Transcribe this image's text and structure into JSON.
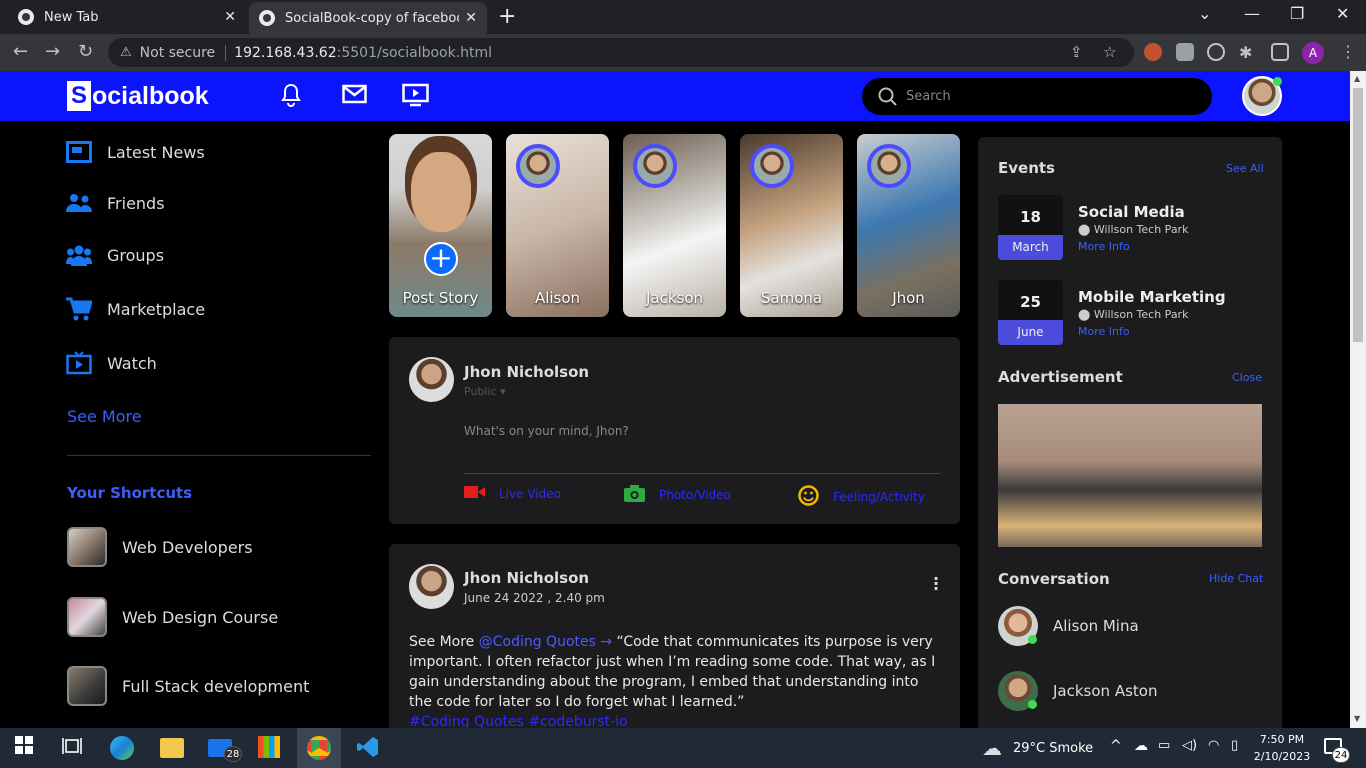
{
  "browser": {
    "tabs": [
      {
        "title": "New Tab",
        "close": "✕"
      },
      {
        "title": "SocialBook-copy of facebook",
        "close": "✕"
      }
    ],
    "new_tab": "+",
    "security_label": "Not secure",
    "url_host": "192.168.43.62",
    "url_path": ":5501/socialbook.html",
    "profile_initial": "A"
  },
  "site": {
    "logo_s": "S",
    "logo_rest": "ocialbook",
    "search_placeholder": "Search"
  },
  "sidebar": {
    "items": [
      {
        "label": "Latest News"
      },
      {
        "label": "Friends"
      },
      {
        "label": "Groups"
      },
      {
        "label": "Marketplace"
      },
      {
        "label": "Watch"
      }
    ],
    "see_more": "See More",
    "shortcuts_title": "Your Shortcuts",
    "shortcuts": [
      {
        "label": "Web Developers"
      },
      {
        "label": "Web Design Course"
      },
      {
        "label": "Full Stack development"
      }
    ]
  },
  "stories": [
    {
      "label": "Post Story"
    },
    {
      "label": "Alison"
    },
    {
      "label": "Jackson"
    },
    {
      "label": "Samona"
    },
    {
      "label": "Jhon"
    }
  ],
  "composer": {
    "name": "Jhon Nicholson",
    "privacy": "Public",
    "placeholder": "What's on your mind, Jhon?",
    "actions": [
      {
        "label": "Live Video"
      },
      {
        "label": "Photo/Video"
      },
      {
        "label": "Feeling/Activity"
      }
    ]
  },
  "post": {
    "name": "Jhon Nicholson",
    "date": "June 24 2022 , 2.40 pm",
    "see_more": "See More ",
    "mention": "@Coding Quotes →",
    "text": " “Code that communicates its purpose is very important. I often refactor just when I’m reading some code. That way, as I gain understanding about the program, I embed that understanding into the code for later so I do forget what I learned.”",
    "tags": "#Coding Quotes #codeburst-io"
  },
  "right": {
    "events_title": "Events",
    "events_link": "See All",
    "events": [
      {
        "day": "18",
        "month": "March",
        "title": "Social Media",
        "location": "Willson Tech Park",
        "more": "More Info"
      },
      {
        "day": "25",
        "month": "June",
        "title": "Mobile Marketing",
        "location": "Willson Tech Park",
        "more": "More Info"
      }
    ],
    "ad_title": "Advertisement",
    "ad_link": "Close",
    "conv_title": "Conversation",
    "conv_link": "Hide Chat",
    "chats": [
      {
        "name": "Alison Mina"
      },
      {
        "name": "Jackson Aston"
      }
    ]
  },
  "taskbar": {
    "mail_badge": "28",
    "weather": "29°C  Smoke",
    "time": "7:50 PM",
    "date": "2/10/2023",
    "notif_badge": "24"
  }
}
